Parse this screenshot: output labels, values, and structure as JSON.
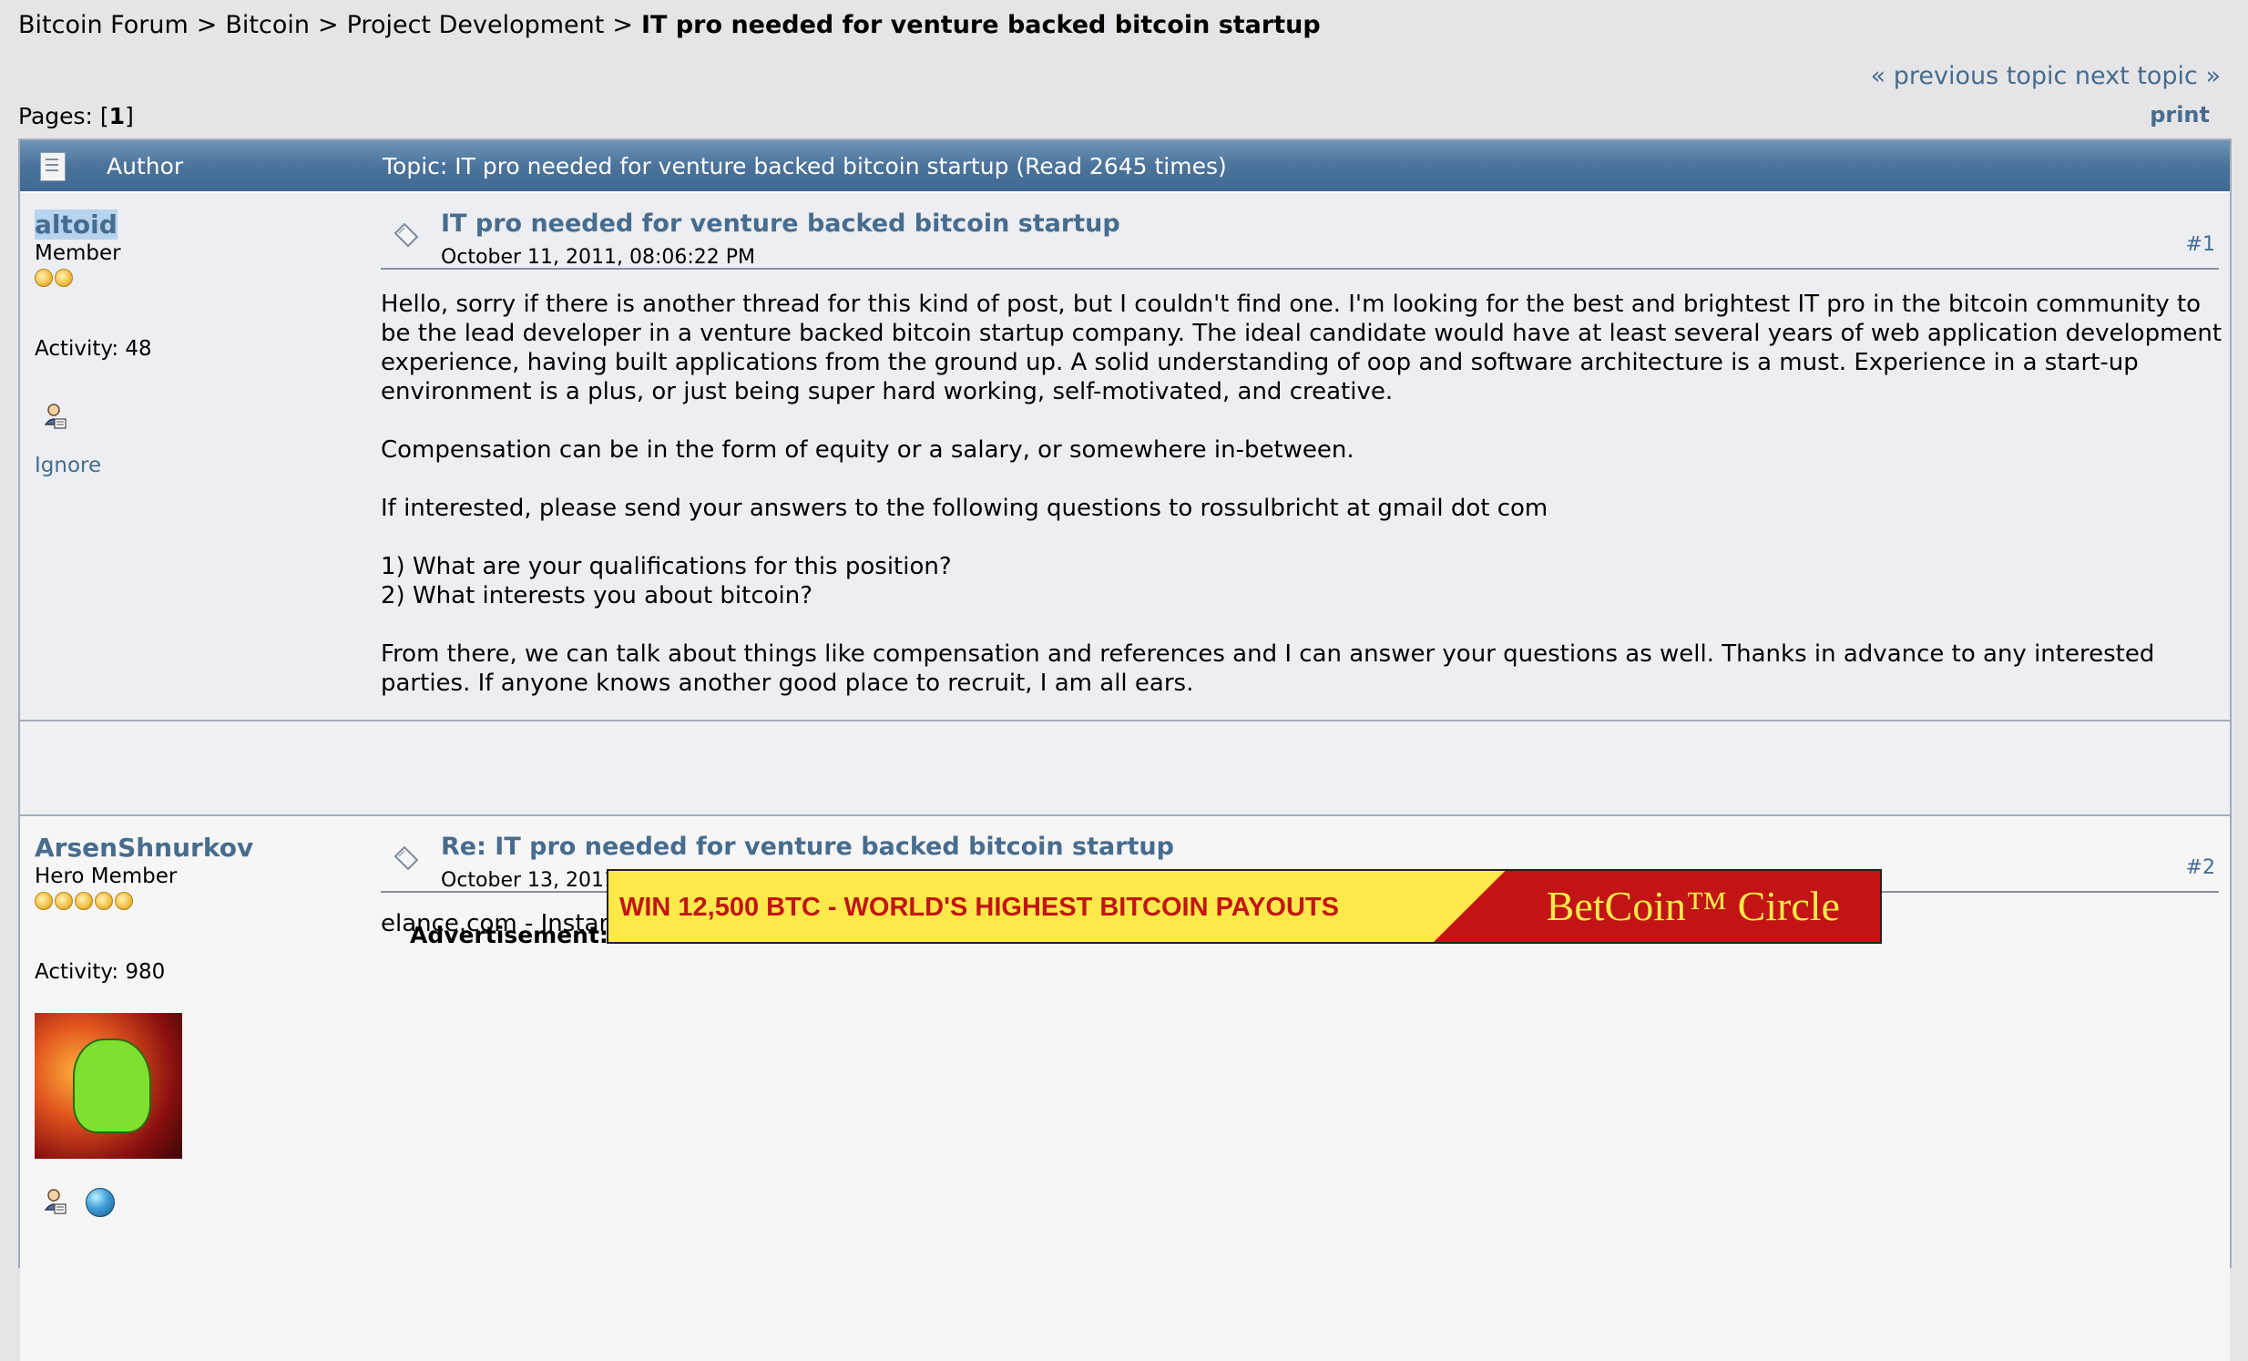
{
  "breadcrumb": {
    "items": [
      "Bitcoin Forum",
      "Bitcoin",
      "Project Development"
    ],
    "separator": ">",
    "current": "IT pro needed for venture backed bitcoin startup"
  },
  "nav": {
    "prev_next": "« previous topic next topic »",
    "print": "print"
  },
  "pages": {
    "label": "Pages: [",
    "current": "1",
    "close": "]"
  },
  "header": {
    "author": "Author",
    "topic": "Topic: IT pro needed for venture backed bitcoin startup  (Read 2645 times)"
  },
  "posts": [
    {
      "author": "altoid",
      "rank": "Member",
      "stars": 2,
      "activity": "Activity: 48",
      "ignore": "Ignore",
      "title": "IT pro needed for venture backed bitcoin startup",
      "date": "October 11, 2011, 08:06:22 PM",
      "number": "#1",
      "body": [
        "Hello, sorry if there is another thread for this kind of post, but I couldn't find one.  I'm looking for the best and brightest IT pro in the bitcoin community to be the lead developer in a venture backed bitcoin startup company.  The ideal candidate would have at least several years of web application development experience, having built applications from the ground up.  A solid understanding of oop and software architecture is a must.  Experience in a start-up environment is a plus, or just being super hard working, self-motivated, and creative.",
        "Compensation can be in the form of equity or a salary, or somewhere in-between.",
        "If interested, please send your answers to the following questions to rossulbricht at gmail dot com",
        "1) What are your qualifications for this position?",
        "2) What interests you about bitcoin?",
        "From there, we can talk about things like compensation and references and I can answer your questions as well.  Thanks in advance to any interested parties.  If anyone knows another good place to recruit, I am all ears."
      ]
    },
    {
      "author": "ArsenShnurkov",
      "rank": "Hero Member",
      "stars": 5,
      "activity": "Activity: 980",
      "title": "Re: IT pro needed for venture backed bitcoin startup",
      "date": "October 13, 2011, 04:28:50 AM",
      "number": "#2",
      "body": [
        "elance.com - Instant access to great talent"
      ]
    }
  ],
  "advertisement": {
    "label": "Advertisement:",
    "text": "WIN 12,500 BTC - WORLD'S HIGHEST BITCOIN PAYOUTS",
    "brand": "BetCoin™ Circle"
  },
  "colors": {
    "link": "#476c8e",
    "header_bar": "#4b739b",
    "ad_yellow": "#ffe94a",
    "ad_red": "#c21414"
  }
}
